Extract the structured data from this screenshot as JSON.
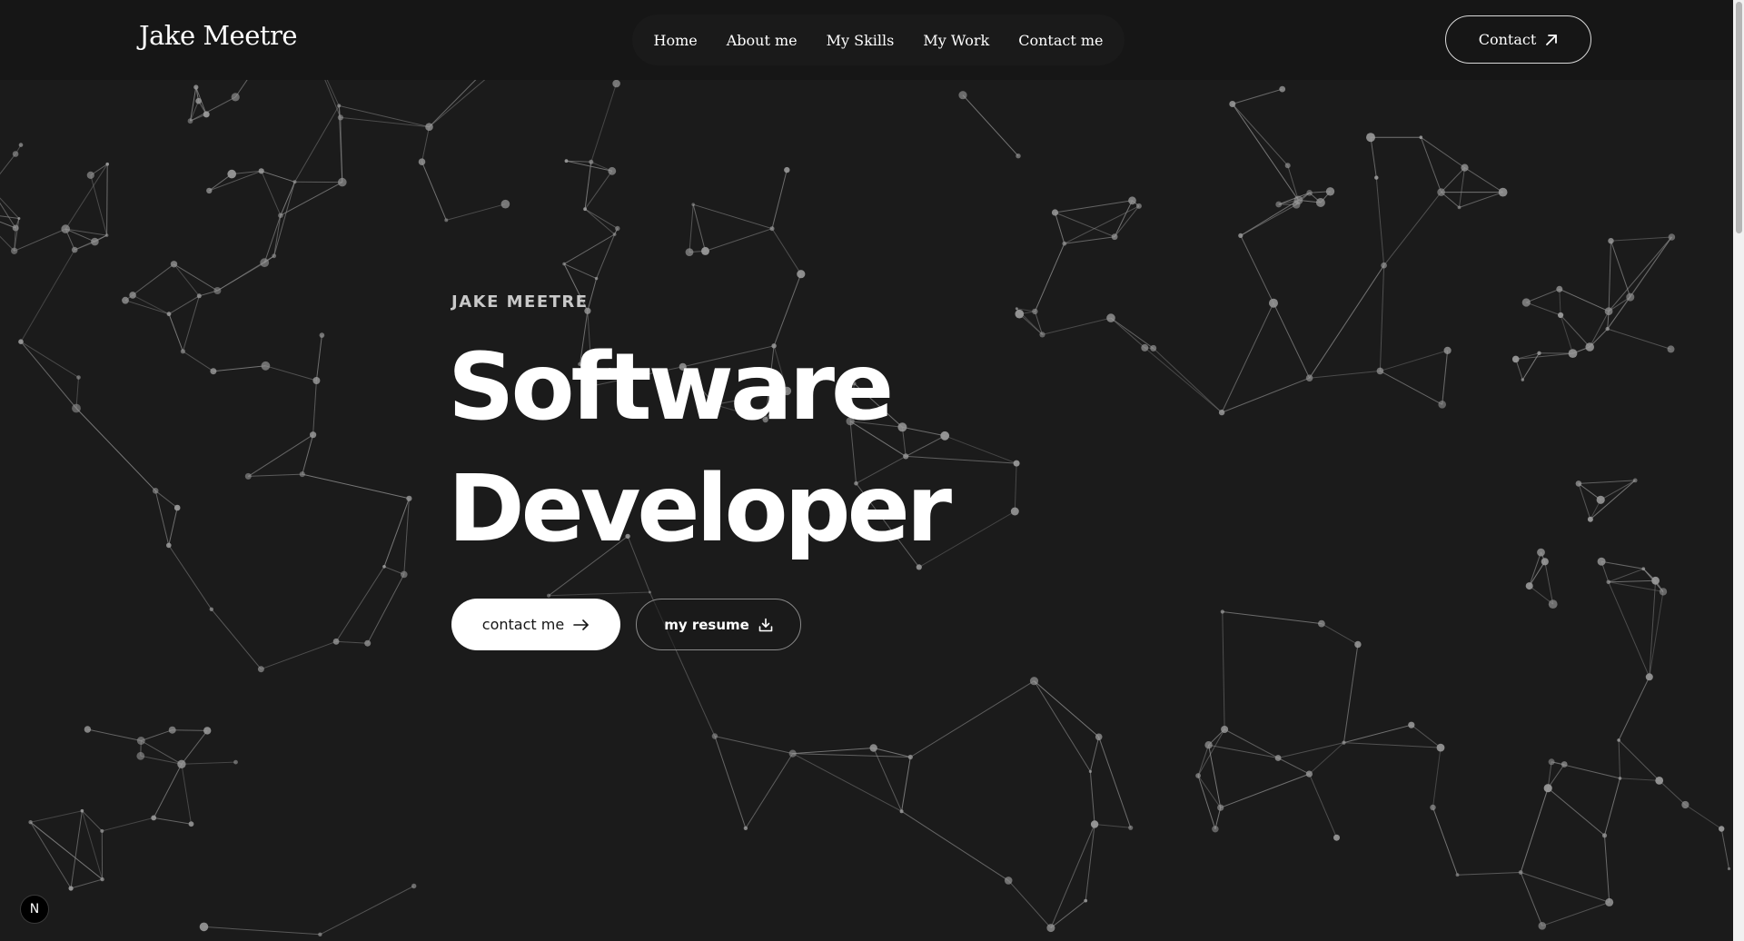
{
  "navbar": {
    "logo": "Jake Meetre",
    "links": [
      "Home",
      "About me",
      "My Skills",
      "My Work",
      "Contact me"
    ],
    "contact_button": "Contact"
  },
  "hero": {
    "eyebrow": "JAKE MEETRE",
    "headline_line1": "Software",
    "headline_line2": "Developer",
    "primary_button": "contact me",
    "secondary_button": "my resume"
  },
  "badge": {
    "letter": "N"
  },
  "icons": {
    "contact": "arrow-up-right-icon",
    "primary": "arrow-right-icon",
    "secondary": "download-icon"
  },
  "colors": {
    "background": "#1b1b1b",
    "navbar": "#161616",
    "network_lines": "#8f8f8f",
    "nodes": "#9a9a9a"
  }
}
